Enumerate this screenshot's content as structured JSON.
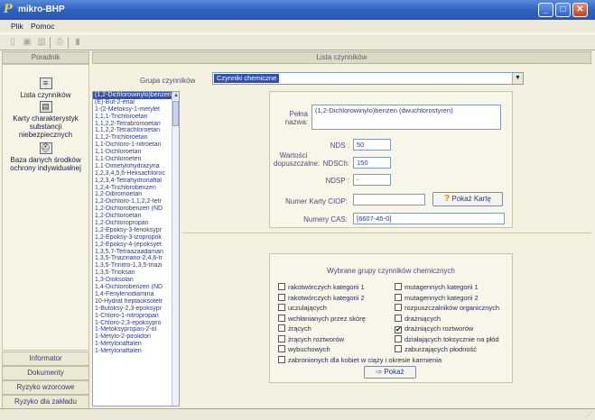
{
  "window": {
    "title": "mikro-BHP",
    "icon_letter": "P",
    "min": "_",
    "max": "□",
    "close": "✕"
  },
  "menu": [
    {
      "label": "Plik"
    },
    {
      "label": "Pomoc"
    }
  ],
  "toolbar_icons": [
    "new-icon",
    "save-icon",
    "delete-icon",
    "print-icon",
    "export-icon"
  ],
  "left": {
    "header": "Poradnik",
    "nav": [
      {
        "label": "Lista czynników",
        "icon": "list-icon",
        "glyph": "≡"
      },
      {
        "label": "Karty charakterystyk substancji niebezpiecznych",
        "icon": "card-icon",
        "glyph": "▤"
      },
      {
        "label": "Baza danych środków ochrony indywidualnej",
        "icon": "protection-icon",
        "glyph": "⛑"
      }
    ],
    "bottom_buttons": [
      "Informator",
      "Dokumenty",
      "Ryzyko wzorcowe",
      "Ryzyko dla zakładu"
    ]
  },
  "right_header": "Lista czynników",
  "group": {
    "label": "Grupa czynników",
    "value": "Czynniki chemiczne",
    "dropdown_glyph": "▼"
  },
  "list": {
    "items": [
      "(1,2-Dichlorowinylo)benzen",
      "(E)-But-2-enal",
      "1-(2-Metoksy-1-metylet",
      "1,1,1-Trichloroetan",
      "1,1,2,2-Tetrabromoetan",
      "1,1,2,2-Tetrachloroetan",
      "1,1,2-Trichloroetan",
      "1,1-Dichloro-1-nitroetan",
      "1,1-Dichloroetan",
      "1,1-Dichloroeten",
      "1,1-Dimetylohydrazyna",
      "1,2,3,4,5,6-Heksachloroc",
      "1,2,3,4-Tetrahydronaftal",
      "1,2,4-Trichlorobenzen",
      "1,2-Dibromoetan",
      "1,2-Dichloro-1,1,2,2-tetr",
      "1,2-Dichlorobenzen (ND",
      "1,2-Dichloroetan",
      "1,2-Dichloropropan",
      "1,2-Epoksy-3-fenoksypr",
      "1,2-Epoksy-3-izopropok",
      "1,2-Epoksy-4-(epoksyet",
      "1,3,5,7-Tetraazaadaman",
      "1,3,5-Triazinano-2,4,6-tr",
      "1,3,5-Trinitro-1,3,5-triazi",
      "1,3,5-Trioksan",
      "1,3-Dioksolan",
      "1,4-Dichlorobenzen (ND",
      "1,4-Fenylenodiamina",
      "10-Hydrat heptaoksotetr",
      "1-Butoksy-2,3-epoksypr",
      "1-Chloro-1-nitropropan",
      "1-Chloro-2,3-epoksypro",
      "1-Metoksypropan-2-ol",
      "1-Metylo-2-pirolidon",
      "1-Metylonaftalen",
      "1-Metylonaftalen"
    ],
    "scroll_up": "▲"
  },
  "detail": {
    "full_name_label": "Pełna nazwa:",
    "full_name": "(1,2-Dichlorowinylo)benzen (dwuchlorostyren)",
    "values_label": "Wartości dopuszczalne:",
    "nds_label": "NDS :",
    "nds": "50",
    "ndsch_label": "NDSCh:",
    "ndsch": "150",
    "ndsp_label": "NDSP :",
    "ndsp": "-",
    "ciop_label": "Numer Karty CIOP:",
    "ciop": "",
    "karta_button": "Pokaż Kartę",
    "karta_glyph": "?",
    "cas_label": "Numery CAS:",
    "cas": "[6607-45-0]"
  },
  "groups": {
    "title": "Wybrane grupy czynników chemicznych",
    "left": [
      {
        "label": "rakotwórczych kategorii 1",
        "checked": false
      },
      {
        "label": "rakotwórczych kategorii 2",
        "checked": false
      },
      {
        "label": "uczulających",
        "checked": false
      },
      {
        "label": "wchłanianych przez skórę",
        "checked": false
      },
      {
        "label": "żrących",
        "checked": false
      },
      {
        "label": "żrących roztworów",
        "checked": false
      },
      {
        "label": "wybuchowych",
        "checked": false
      }
    ],
    "right": [
      {
        "label": "mutagennych kategorii 1",
        "checked": false
      },
      {
        "label": "mutagennych kategorii 2",
        "checked": false
      },
      {
        "label": "rozpuszczalników organicznych",
        "checked": false
      },
      {
        "label": "drażniących",
        "checked": false
      },
      {
        "label": "drażniących roztworów",
        "checked": true
      },
      {
        "label": "działających toksycznie na płód",
        "checked": false
      },
      {
        "label": "zaburzających płodność",
        "checked": false
      }
    ],
    "bottom": {
      "label": "zabronionych dla kobiet w ciąży i okresie karmienia",
      "checked": false
    },
    "check_glyph": "✔",
    "show_button": "Pokaż",
    "show_glyph": "⇨"
  },
  "status": {
    "grip": "⋰"
  }
}
